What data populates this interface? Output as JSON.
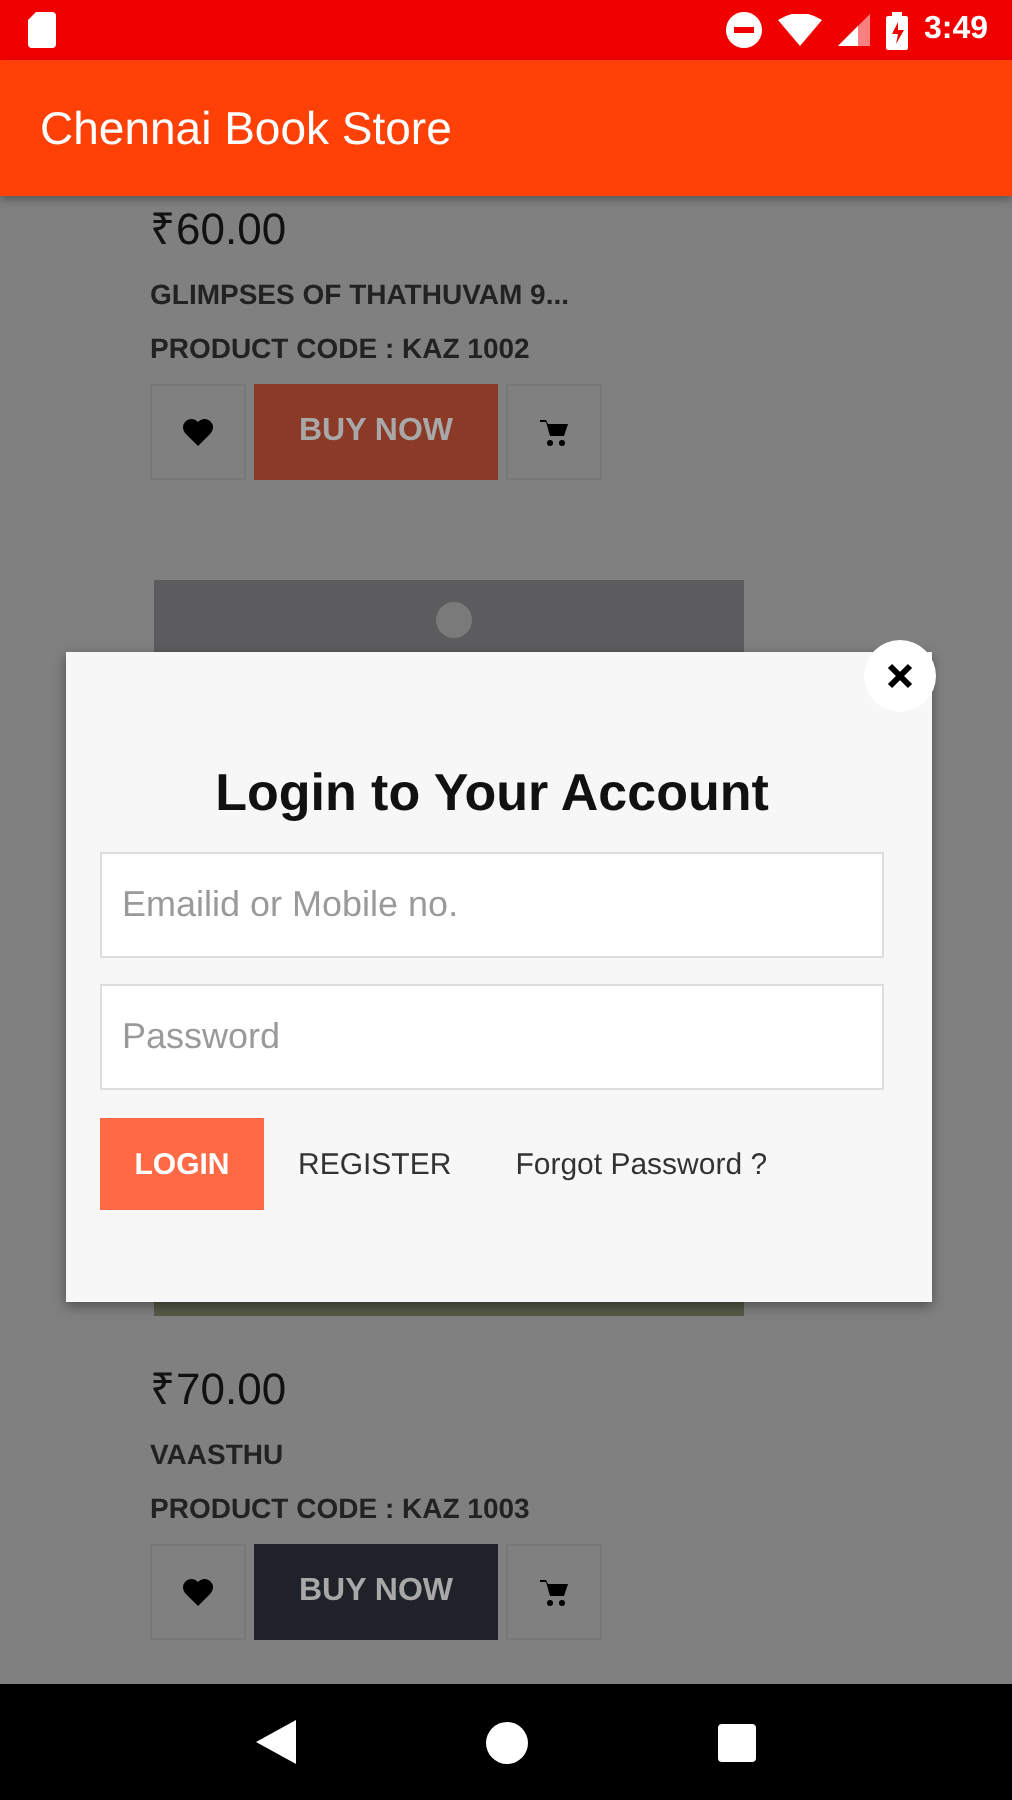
{
  "status_bar": {
    "time": "3:49"
  },
  "app_bar": {
    "title": "Chennai Book Store"
  },
  "products": [
    {
      "price": "₹60.00",
      "title": "GLIMPSES OF THATHUVAM 9...",
      "code": "PRODUCT CODE : KAZ 1002",
      "buy_label": "BUY NOW",
      "color": "#8a3a26"
    },
    {
      "price": "₹70.00",
      "title": "VAASTHU",
      "code": "PRODUCT CODE : KAZ 1003",
      "buy_label": "BUY NOW",
      "color": "#1f2329"
    }
  ],
  "dialog": {
    "title": "Login to Your Account",
    "fields": [
      {
        "placeholder": "Emailid or Mobile no."
      },
      {
        "placeholder": "Password"
      }
    ],
    "login": "LOGIN",
    "register": "REGISTER",
    "forgot": "Forgot Password ?"
  }
}
